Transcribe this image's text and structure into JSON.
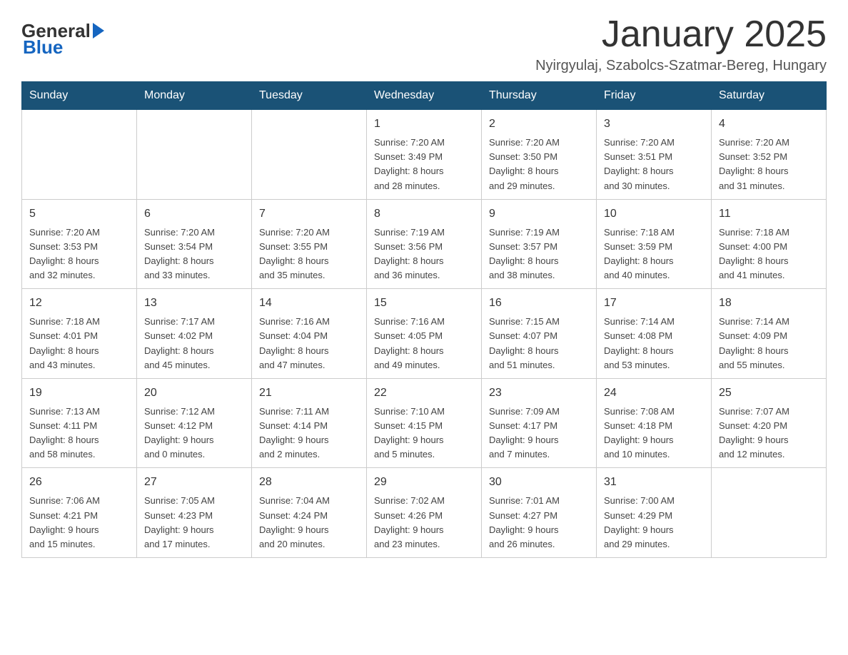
{
  "header": {
    "logo_general": "General",
    "logo_blue": "Blue",
    "month_title": "January 2025",
    "location": "Nyirgyulaj, Szabolcs-Szatmar-Bereg, Hungary"
  },
  "days_of_week": [
    "Sunday",
    "Monday",
    "Tuesday",
    "Wednesday",
    "Thursday",
    "Friday",
    "Saturday"
  ],
  "weeks": [
    [
      {
        "day": "",
        "info": ""
      },
      {
        "day": "",
        "info": ""
      },
      {
        "day": "",
        "info": ""
      },
      {
        "day": "1",
        "info": "Sunrise: 7:20 AM\nSunset: 3:49 PM\nDaylight: 8 hours\nand 28 minutes."
      },
      {
        "day": "2",
        "info": "Sunrise: 7:20 AM\nSunset: 3:50 PM\nDaylight: 8 hours\nand 29 minutes."
      },
      {
        "day": "3",
        "info": "Sunrise: 7:20 AM\nSunset: 3:51 PM\nDaylight: 8 hours\nand 30 minutes."
      },
      {
        "day": "4",
        "info": "Sunrise: 7:20 AM\nSunset: 3:52 PM\nDaylight: 8 hours\nand 31 minutes."
      }
    ],
    [
      {
        "day": "5",
        "info": "Sunrise: 7:20 AM\nSunset: 3:53 PM\nDaylight: 8 hours\nand 32 minutes."
      },
      {
        "day": "6",
        "info": "Sunrise: 7:20 AM\nSunset: 3:54 PM\nDaylight: 8 hours\nand 33 minutes."
      },
      {
        "day": "7",
        "info": "Sunrise: 7:20 AM\nSunset: 3:55 PM\nDaylight: 8 hours\nand 35 minutes."
      },
      {
        "day": "8",
        "info": "Sunrise: 7:19 AM\nSunset: 3:56 PM\nDaylight: 8 hours\nand 36 minutes."
      },
      {
        "day": "9",
        "info": "Sunrise: 7:19 AM\nSunset: 3:57 PM\nDaylight: 8 hours\nand 38 minutes."
      },
      {
        "day": "10",
        "info": "Sunrise: 7:18 AM\nSunset: 3:59 PM\nDaylight: 8 hours\nand 40 minutes."
      },
      {
        "day": "11",
        "info": "Sunrise: 7:18 AM\nSunset: 4:00 PM\nDaylight: 8 hours\nand 41 minutes."
      }
    ],
    [
      {
        "day": "12",
        "info": "Sunrise: 7:18 AM\nSunset: 4:01 PM\nDaylight: 8 hours\nand 43 minutes."
      },
      {
        "day": "13",
        "info": "Sunrise: 7:17 AM\nSunset: 4:02 PM\nDaylight: 8 hours\nand 45 minutes."
      },
      {
        "day": "14",
        "info": "Sunrise: 7:16 AM\nSunset: 4:04 PM\nDaylight: 8 hours\nand 47 minutes."
      },
      {
        "day": "15",
        "info": "Sunrise: 7:16 AM\nSunset: 4:05 PM\nDaylight: 8 hours\nand 49 minutes."
      },
      {
        "day": "16",
        "info": "Sunrise: 7:15 AM\nSunset: 4:07 PM\nDaylight: 8 hours\nand 51 minutes."
      },
      {
        "day": "17",
        "info": "Sunrise: 7:14 AM\nSunset: 4:08 PM\nDaylight: 8 hours\nand 53 minutes."
      },
      {
        "day": "18",
        "info": "Sunrise: 7:14 AM\nSunset: 4:09 PM\nDaylight: 8 hours\nand 55 minutes."
      }
    ],
    [
      {
        "day": "19",
        "info": "Sunrise: 7:13 AM\nSunset: 4:11 PM\nDaylight: 8 hours\nand 58 minutes."
      },
      {
        "day": "20",
        "info": "Sunrise: 7:12 AM\nSunset: 4:12 PM\nDaylight: 9 hours\nand 0 minutes."
      },
      {
        "day": "21",
        "info": "Sunrise: 7:11 AM\nSunset: 4:14 PM\nDaylight: 9 hours\nand 2 minutes."
      },
      {
        "day": "22",
        "info": "Sunrise: 7:10 AM\nSunset: 4:15 PM\nDaylight: 9 hours\nand 5 minutes."
      },
      {
        "day": "23",
        "info": "Sunrise: 7:09 AM\nSunset: 4:17 PM\nDaylight: 9 hours\nand 7 minutes."
      },
      {
        "day": "24",
        "info": "Sunrise: 7:08 AM\nSunset: 4:18 PM\nDaylight: 9 hours\nand 10 minutes."
      },
      {
        "day": "25",
        "info": "Sunrise: 7:07 AM\nSunset: 4:20 PM\nDaylight: 9 hours\nand 12 minutes."
      }
    ],
    [
      {
        "day": "26",
        "info": "Sunrise: 7:06 AM\nSunset: 4:21 PM\nDaylight: 9 hours\nand 15 minutes."
      },
      {
        "day": "27",
        "info": "Sunrise: 7:05 AM\nSunset: 4:23 PM\nDaylight: 9 hours\nand 17 minutes."
      },
      {
        "day": "28",
        "info": "Sunrise: 7:04 AM\nSunset: 4:24 PM\nDaylight: 9 hours\nand 20 minutes."
      },
      {
        "day": "29",
        "info": "Sunrise: 7:02 AM\nSunset: 4:26 PM\nDaylight: 9 hours\nand 23 minutes."
      },
      {
        "day": "30",
        "info": "Sunrise: 7:01 AM\nSunset: 4:27 PM\nDaylight: 9 hours\nand 26 minutes."
      },
      {
        "day": "31",
        "info": "Sunrise: 7:00 AM\nSunset: 4:29 PM\nDaylight: 9 hours\nand 29 minutes."
      },
      {
        "day": "",
        "info": ""
      }
    ]
  ]
}
